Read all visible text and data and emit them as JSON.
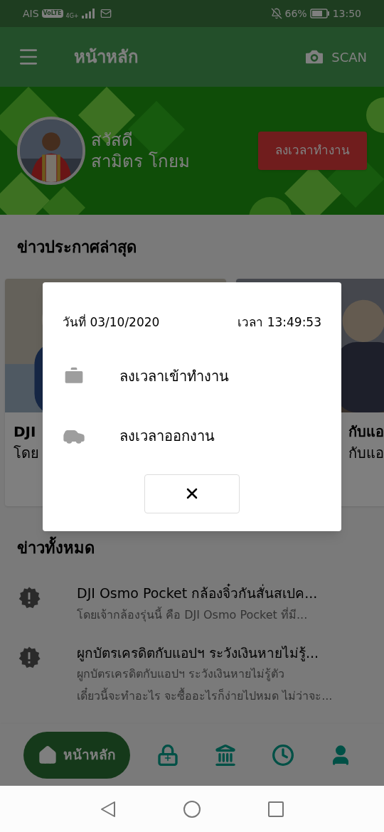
{
  "status_bar": {
    "carrier": "AIS",
    "volte": "VoLTE",
    "network": "4G+",
    "battery": "66%",
    "time": "13:50"
  },
  "app_bar": {
    "title": "หน้าหลัก",
    "scan": "SCAN"
  },
  "banner": {
    "greeting": "สวัสดี",
    "name": "สามิตร โกยม",
    "button": "ลงเวลาทำงาน"
  },
  "latest_news": {
    "heading": "ข่าวประกาศล่าสุด",
    "cards": [
      {
        "title": "DJI",
        "summary": "โดย"
      },
      {
        "title": "กับแอ",
        "summary": "กับแอ"
      }
    ]
  },
  "all_news": {
    "heading": "ข่าวทั้งหมด",
    "items": [
      {
        "title": "DJI Osmo Pocket กล้องจิ๋วกันสั่นสเปค...",
        "summary": "โดยเจ้ากล้องรุ่นนี้ คือ DJI Osmo Pocket ที่มี..."
      },
      {
        "title": "ผูกบัตรเครดิตกับแอปฯ ระวังเงินหายไม่รู้...",
        "summary": "ผูกบัตรเครดิตกับแอปฯ ระวังเงินหายไม่รู้ตัว\nเดี๋ยวนี้จะทำอะไร จะซื้ออะไรก็ง่ายไปหมด ไม่ว่าจะ..."
      }
    ]
  },
  "bottom_nav": [
    {
      "kind": "home",
      "label": "หน้าหลัก",
      "selected": true
    },
    {
      "kind": "lock",
      "selected": false
    },
    {
      "kind": "bank",
      "selected": false
    },
    {
      "kind": "clock",
      "selected": false
    },
    {
      "kind": "person",
      "selected": false
    }
  ],
  "dialog": {
    "date": "วันที่ 03/10/2020",
    "time": "เวลา 13:49:53",
    "actions": [
      {
        "kind": "briefcase",
        "label": "ลงเวลาเข้าทำงาน"
      },
      {
        "kind": "car",
        "label": "ลงเวลาออกงาน"
      }
    ]
  }
}
